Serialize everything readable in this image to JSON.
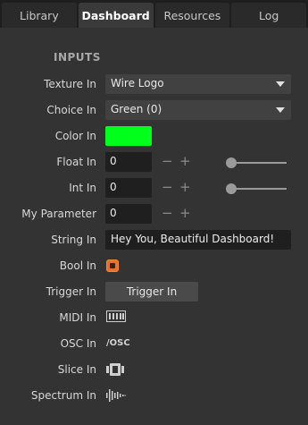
{
  "tabs": [
    {
      "label": "Library"
    },
    {
      "label": "Dashboard"
    },
    {
      "label": "Resources"
    },
    {
      "label": "Log"
    }
  ],
  "section": {
    "title": "INPUTS"
  },
  "inputs": {
    "texture": {
      "label": "Texture In",
      "value": "Wire Logo"
    },
    "choice": {
      "label": "Choice In",
      "value": "Green (0)"
    },
    "color": {
      "label": "Color In",
      "value": "#00ff1a"
    },
    "float": {
      "label": "Float In",
      "value": "0",
      "minus": "−",
      "plus": "+",
      "slider_fraction": 0
    },
    "int": {
      "label": "Int In",
      "value": "0",
      "minus": "−",
      "plus": "+",
      "slider_fraction": 0
    },
    "my_parameter": {
      "label": "My Parameter",
      "value": "0",
      "minus": "−",
      "plus": "+"
    },
    "string": {
      "label": "String In",
      "value": "Hey You, Beautiful Dashboard!"
    },
    "bool": {
      "label": "Bool In",
      "checked": true,
      "color": "#e8702a"
    },
    "trigger": {
      "label": "Trigger In",
      "button": "Trigger In"
    },
    "midi": {
      "label": "MIDI In",
      "icon": "midi-icon"
    },
    "osc": {
      "label": "OSC In",
      "icon_text": "/OSC"
    },
    "slice": {
      "label": "Slice In",
      "icon": "slice-icon"
    },
    "spectrum": {
      "label": "Spectrum In",
      "icon": "spectrum-icon"
    }
  }
}
